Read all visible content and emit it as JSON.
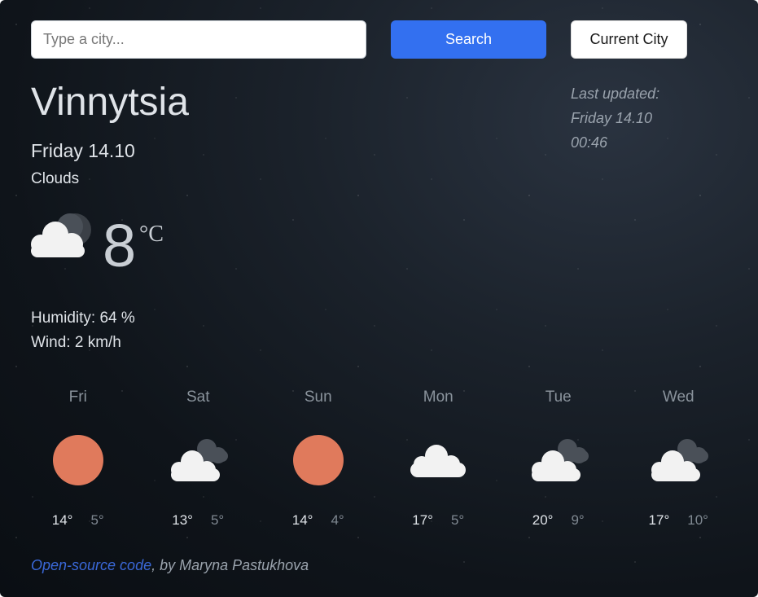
{
  "search": {
    "placeholder": "Type a city...",
    "button_label": "Search",
    "current_label": "Current City"
  },
  "current": {
    "city": "Vinnytsia",
    "date": "Friday 14.10",
    "description": "Clouds",
    "temperature": "8",
    "unit": "°C",
    "humidity": "Humidity: 64 %",
    "wind": "Wind: 2 km/h",
    "icon": "cloud-moon-icon"
  },
  "last_updated": {
    "label": "Last updated:",
    "date": "Friday 14.10",
    "time": "00:46"
  },
  "forecast": [
    {
      "day": "Fri",
      "max": "14°",
      "min": "5°",
      "icon": "sun-icon"
    },
    {
      "day": "Sat",
      "max": "13°",
      "min": "5°",
      "icon": "broken-clouds-icon"
    },
    {
      "day": "Sun",
      "max": "14°",
      "min": "4°",
      "icon": "sun-icon"
    },
    {
      "day": "Mon",
      "max": "17°",
      "min": "5°",
      "icon": "cloud-icon"
    },
    {
      "day": "Tue",
      "max": "20°",
      "min": "9°",
      "icon": "broken-clouds-icon"
    },
    {
      "day": "Wed",
      "max": "17°",
      "min": "10°",
      "icon": "broken-clouds-icon"
    }
  ],
  "footer": {
    "link_text": "Open-source code",
    "by_text": ", by Maryna Pastukhova"
  },
  "colors": {
    "accent": "#3370f0",
    "sun": "#e07a5c",
    "link": "#3a68d8"
  }
}
